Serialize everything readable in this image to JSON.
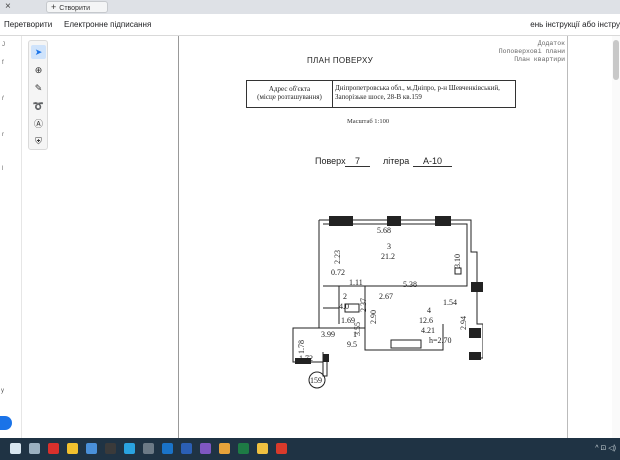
{
  "browser": {
    "tab_close": "×",
    "new_tab_label": "Створити",
    "new_tab_plus": "+"
  },
  "menubar": {
    "convert": "Перетворити",
    "esign": "Електронне підписання",
    "right_text": "ень інструкції або інстру"
  },
  "left_panel": {
    "glyphs": [
      "J",
      "f",
      "ŕ",
      "r",
      "l"
    ],
    "y_text": "y"
  },
  "tools": [
    {
      "icon": "select-arrow-icon",
      "glyph": "➤",
      "active": true
    },
    {
      "icon": "zoom-add-icon",
      "glyph": "⊕",
      "active": false
    },
    {
      "icon": "pen-icon",
      "glyph": "✎",
      "active": false
    },
    {
      "icon": "lasso-icon",
      "glyph": "➰",
      "active": false
    },
    {
      "icon": "text-box-icon",
      "glyph": "Ⓐ",
      "active": false
    },
    {
      "icon": "stamp-icon",
      "glyph": "⛨",
      "active": false
    }
  ],
  "document": {
    "title": "ПЛАН ПОВЕРХУ",
    "appendix_line1": "Додаток",
    "appendix_line2": "Поповерхові плани",
    "appendix_line3": "План квартири",
    "address_label_1": "Адрес об'єкта",
    "address_label_2": "(місце розташування)",
    "address_value_1": "Дніпропетровська обл., м.Дніпро, р-н Шевченківський,",
    "address_value_2": "Запорізьке шосе, 28-В кв.159",
    "scale": "Масштаб 1:100",
    "floor_label": "Поверх",
    "floor_value": "7",
    "letter_label": "літера",
    "letter_value": "А-10"
  },
  "plan": {
    "dims": {
      "top_width": "5.68",
      "left_upper": "2.23",
      "right_upper": "3.10",
      "room3_num": "3",
      "room3_area": "21.2",
      "d072": "0.72",
      "d111": "1.11",
      "d538": "5.38",
      "d267": "2.67",
      "d154": "1.54",
      "room2_num": "2",
      "room2_area": "4.0",
      "d237": "2.37",
      "d290": "2.90",
      "room4_num": "4",
      "room4_area": "12.6",
      "d294": "2.94",
      "d355": "3.55",
      "d169": "1.69",
      "room1_num": "1",
      "room1_area": "9.5",
      "d399": "3.99",
      "d421": "4.21",
      "height": "h=2.70",
      "d178": "1.78",
      "d172": "1.72",
      "apt_number": "159"
    }
  },
  "taskbar": {
    "icons": [
      {
        "name": "windows-start-icon",
        "color": "#d8e6f0"
      },
      {
        "name": "search-icon",
        "color": "#9bb0c0"
      },
      {
        "name": "opera-icon",
        "color": "#d9302c"
      },
      {
        "name": "chrome-icon",
        "color": "#f2c12e"
      },
      {
        "name": "chrome-alt-icon",
        "color": "#4a90d9"
      },
      {
        "name": "media-player-icon",
        "color": "#3a3a3a"
      },
      {
        "name": "telegram-icon",
        "color": "#2aa3e0"
      },
      {
        "name": "calculator-icon",
        "color": "#6c7a86"
      },
      {
        "name": "outlook-icon",
        "color": "#1a73c8"
      },
      {
        "name": "word-icon",
        "color": "#2b5fb4"
      },
      {
        "name": "photos-icon",
        "color": "#7e57c2"
      },
      {
        "name": "chrome-profile-icon",
        "color": "#e8a33a"
      },
      {
        "name": "excel-icon",
        "color": "#1e7b45"
      },
      {
        "name": "explorer-icon",
        "color": "#f0c040"
      },
      {
        "name": "acrobat-icon",
        "color": "#d93a2b"
      }
    ],
    "tray": "^  ⊡  ◁)"
  }
}
